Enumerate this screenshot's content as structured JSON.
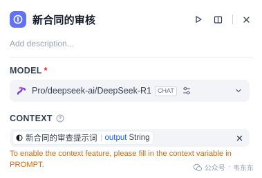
{
  "node": {
    "title": "新合同的审核",
    "icon": "llm-node-icon",
    "accent_color": "#6172f3",
    "description_placeholder": "Add description..."
  },
  "header_actions": [
    "run-icon",
    "toggle-panel-icon",
    "close-icon"
  ],
  "model": {
    "label": "MODEL",
    "required_mark": "*",
    "name": "Pro/deepseek-ai/DeepSeek-R1",
    "badge": "CHAT",
    "provider_icon": "siliconflow-logo-icon"
  },
  "context": {
    "label": "CONTEXT",
    "variable": {
      "node_name": "新合同的审查提示词",
      "var_name": "output",
      "var_type": "String"
    },
    "warning": "To enable the context feature, please fill in the context variable in PROMPT."
  },
  "watermark": {
    "platform": "公众号",
    "author": "韦东东"
  },
  "colors": {
    "warning": "#dc6803",
    "variable": "#155eef",
    "required": "#d92d20"
  }
}
